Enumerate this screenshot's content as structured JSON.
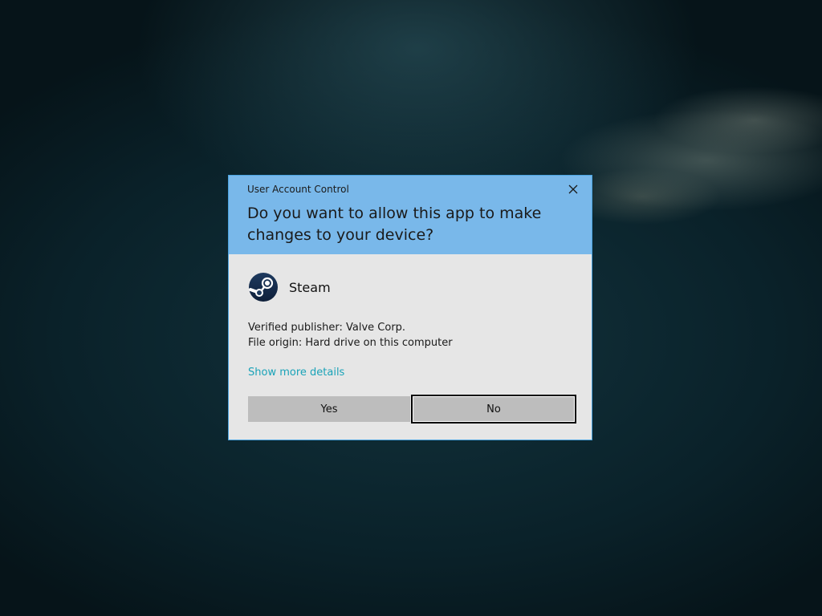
{
  "dialog": {
    "title": "User Account Control",
    "question": "Do you want to allow this app to make changes to your device?",
    "app_name": "Steam",
    "publisher": "Verified publisher: Valve Corp.",
    "origin": "File origin: Hard drive on this computer",
    "details_link": "Show more details",
    "yes_label": "Yes",
    "no_label": "No",
    "close_icon": "close-icon",
    "app_icon": "steam-icon"
  },
  "colors": {
    "header": "#79b8ea",
    "body": "#e6e6e6",
    "link": "#1aa3b8",
    "button": "#bdbdbd",
    "border": "#4aa3df"
  }
}
